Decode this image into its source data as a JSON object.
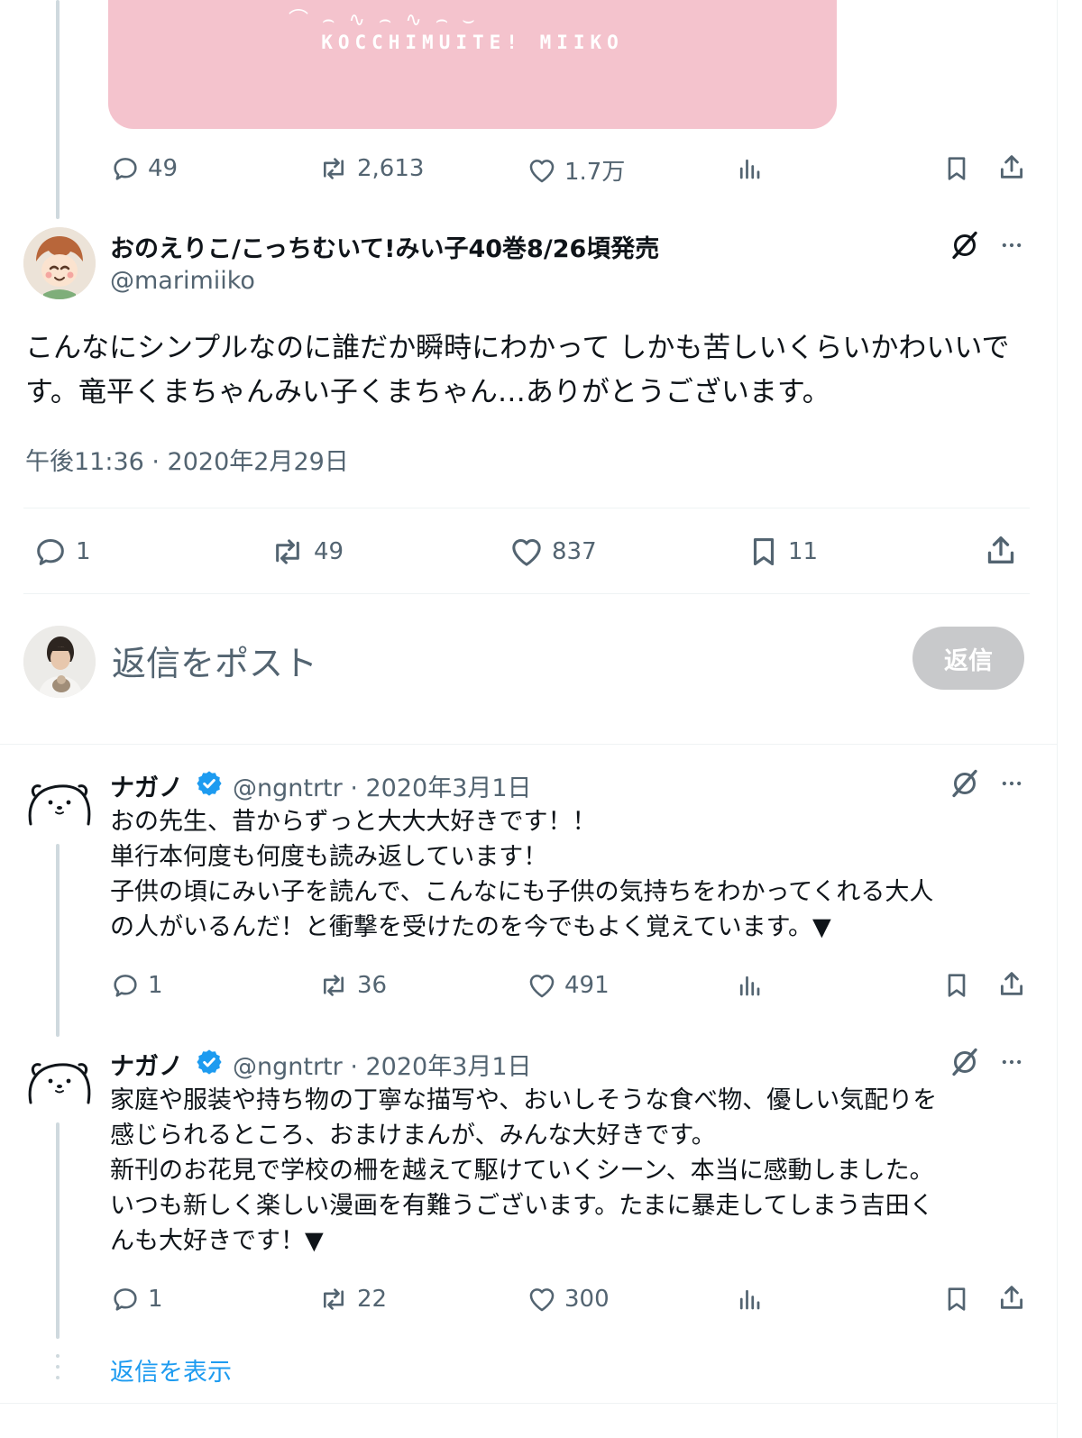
{
  "top_tweet": {
    "media_logo_text": "KOCCHIMUITE! MIIKO",
    "actions": {
      "replies": "49",
      "retweets": "2,613",
      "likes": "1.7万"
    }
  },
  "main_tweet": {
    "display_name": "おのえりこ/こっちむいて!みい子40巻8/26頃発売",
    "handle": "@marimiiko",
    "text": "こんなにシンプルなのに誰だか瞬時にわかって しかも苦しいくらいかわいいです。竜平くまちゃんみい子くまちゃん…ありがとうございます。",
    "timestamp": "午後11:36 · 2020年2月29日",
    "actions": {
      "replies": "1",
      "retweets": "49",
      "likes": "837",
      "bookmarks": "11"
    }
  },
  "reply_box": {
    "placeholder": "返信をポスト",
    "button_label": "返信"
  },
  "replies": [
    {
      "display_name": "ナガノ",
      "handle_date": "@ngntrtr · 2020年3月1日",
      "lines": [
        "おの先生、昔からずっと大大大好きです！！",
        "単行本何度も何度も読み返しています！",
        "子供の頃にみい子を読んで、こんなにも子供の気持ちをわかってくれる大人",
        "の人がいるんだ！と衝撃を受けたのを今でもよく覚えています。▼"
      ],
      "actions": {
        "replies": "1",
        "retweets": "36",
        "likes": "491"
      }
    },
    {
      "display_name": "ナガノ",
      "handle_date": "@ngntrtr · 2020年3月1日",
      "lines": [
        "家庭や服装や持ち物の丁寧な描写や、おいしそうな食べ物、優しい気配りを",
        "感じられるところ、おまけまんが、みんな大好きです。",
        "新刊のお花見で学校の柵を越えて駆けていくシーン、本当に感動しました。",
        "いつも新しく楽しい漫画を有難うございます。たまに暴走してしまう吉田く",
        "んも大好きです！▼"
      ],
      "actions": {
        "replies": "1",
        "retweets": "22",
        "likes": "300"
      }
    }
  ],
  "show_replies_label": "返信を表示",
  "colors": {
    "text_primary": "#0f1419",
    "text_secondary": "#536471",
    "link": "#1d9bf0",
    "verified": "#1d9bf0",
    "media_bg": "#f4c3cd",
    "reply_button_bg": "#c8c9cb"
  },
  "icons": [
    "reply-icon",
    "retweet-icon",
    "like-icon",
    "views-icon",
    "bookmark-icon",
    "share-icon",
    "grok-icon",
    "more-icon",
    "verified-icon"
  ]
}
